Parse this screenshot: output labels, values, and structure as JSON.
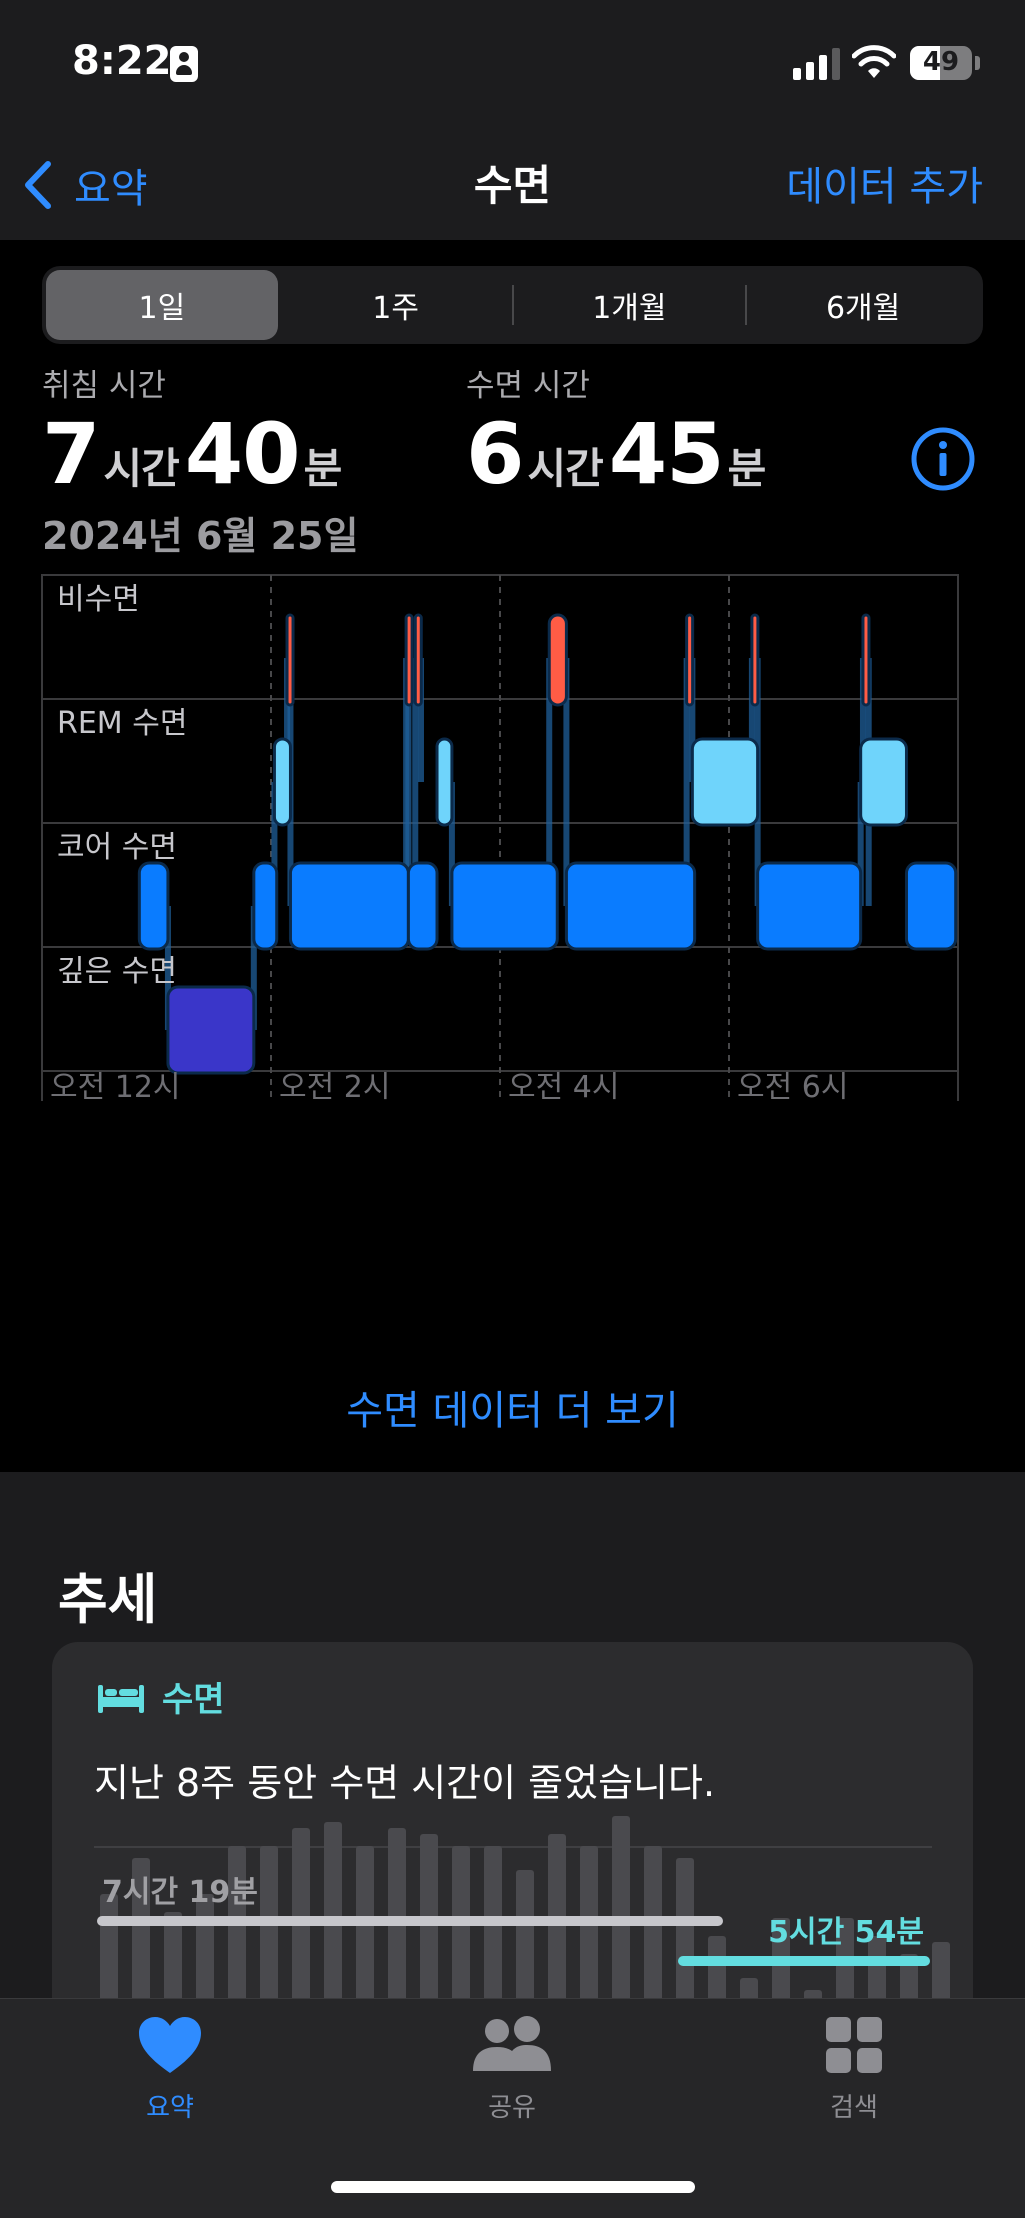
{
  "status_bar": {
    "time": "8:22",
    "battery": "49",
    "battery_level": 0.49,
    "signal_bars": 3
  },
  "nav": {
    "back_label": "요약",
    "title": "수면",
    "add_label": "데이터 추가"
  },
  "segments": [
    {
      "label": "1일",
      "active": true
    },
    {
      "label": "1주",
      "active": false
    },
    {
      "label": "1개월",
      "active": false
    },
    {
      "label": "6개월",
      "active": false
    }
  ],
  "summary": {
    "in_bed": {
      "label": "취침 시간",
      "hours": "7",
      "hours_unit": "시간",
      "minutes": "40",
      "minutes_unit": "분"
    },
    "asleep": {
      "label": "수면 시간",
      "hours": "6",
      "hours_unit": "시간",
      "minutes": "45",
      "minutes_unit": "분"
    },
    "date": "2024년 6월 25일"
  },
  "chart_data": {
    "type": "sleep-stages",
    "stages": [
      "비수면",
      "REM 수면",
      "코어 수면",
      "깊은 수면"
    ],
    "x_ticks": [
      "오전 12시",
      "오전 2시",
      "오전 4시",
      "오전 6시"
    ],
    "x_range_hours": [
      0,
      8
    ],
    "segments": [
      {
        "stage": 2,
        "start": 0.85,
        "end": 1.1
      },
      {
        "stage": 3,
        "start": 1.1,
        "end": 1.85
      },
      {
        "stage": 2,
        "start": 1.85,
        "end": 2.05
      },
      {
        "stage": 1,
        "start": 2.03,
        "end": 2.17
      },
      {
        "stage": 0,
        "start": 2.14,
        "end": 2.19
      },
      {
        "stage": 2,
        "start": 2.17,
        "end": 3.2
      },
      {
        "stage": 0,
        "start": 3.18,
        "end": 3.23
      },
      {
        "stage": 0,
        "start": 3.26,
        "end": 3.31
      },
      {
        "stage": 2,
        "start": 3.2,
        "end": 3.45
      },
      {
        "stage": 1,
        "start": 3.45,
        "end": 3.58
      },
      {
        "stage": 2,
        "start": 3.58,
        "end": 4.5
      },
      {
        "stage": 0,
        "start": 4.43,
        "end": 4.58
      },
      {
        "stage": 2,
        "start": 4.58,
        "end": 5.7
      },
      {
        "stage": 0,
        "start": 5.63,
        "end": 5.68
      },
      {
        "stage": 1,
        "start": 5.68,
        "end": 6.25
      },
      {
        "stage": 0,
        "start": 6.2,
        "end": 6.25
      },
      {
        "stage": 2,
        "start": 6.25,
        "end": 7.15
      },
      {
        "stage": 1,
        "start": 7.15,
        "end": 7.55
      },
      {
        "stage": 0,
        "start": 7.17,
        "end": 7.22
      },
      {
        "stage": 2,
        "start": 7.55,
        "end": 7.98
      }
    ]
  },
  "more_link": "수면 데이터 더 보기",
  "trends": {
    "title": "추세",
    "card_label": "수면",
    "card_text": "지난 8주 동안 수면 시간이 줄었습니다.",
    "avg_before": "7시간 19분",
    "avg_after": "5시간 54분",
    "bar_values_hours": [
      6.8,
      7.4,
      6.5,
      6.8,
      7.6,
      7.6,
      7.9,
      8.0,
      7.6,
      7.9,
      7.8,
      7.6,
      7.6,
      7.2,
      7.8,
      7.6,
      8.1,
      7.6,
      7.4,
      6.1,
      5.4,
      6.4,
      5.2,
      6.4,
      6.1,
      5.8,
      6.0
    ]
  },
  "tabs": [
    {
      "label": "요약",
      "icon": "heart-icon",
      "active": true
    },
    {
      "label": "공유",
      "icon": "people-icon",
      "active": false
    },
    {
      "label": "검색",
      "icon": "grid-icon",
      "active": false
    }
  ],
  "colors": {
    "accent": "#2f8cff",
    "awake": "#ff5c45",
    "rem": "#6fd4fb",
    "core": "#0a7cff",
    "deep": "#3a36c9",
    "trend": "#63dde0"
  }
}
